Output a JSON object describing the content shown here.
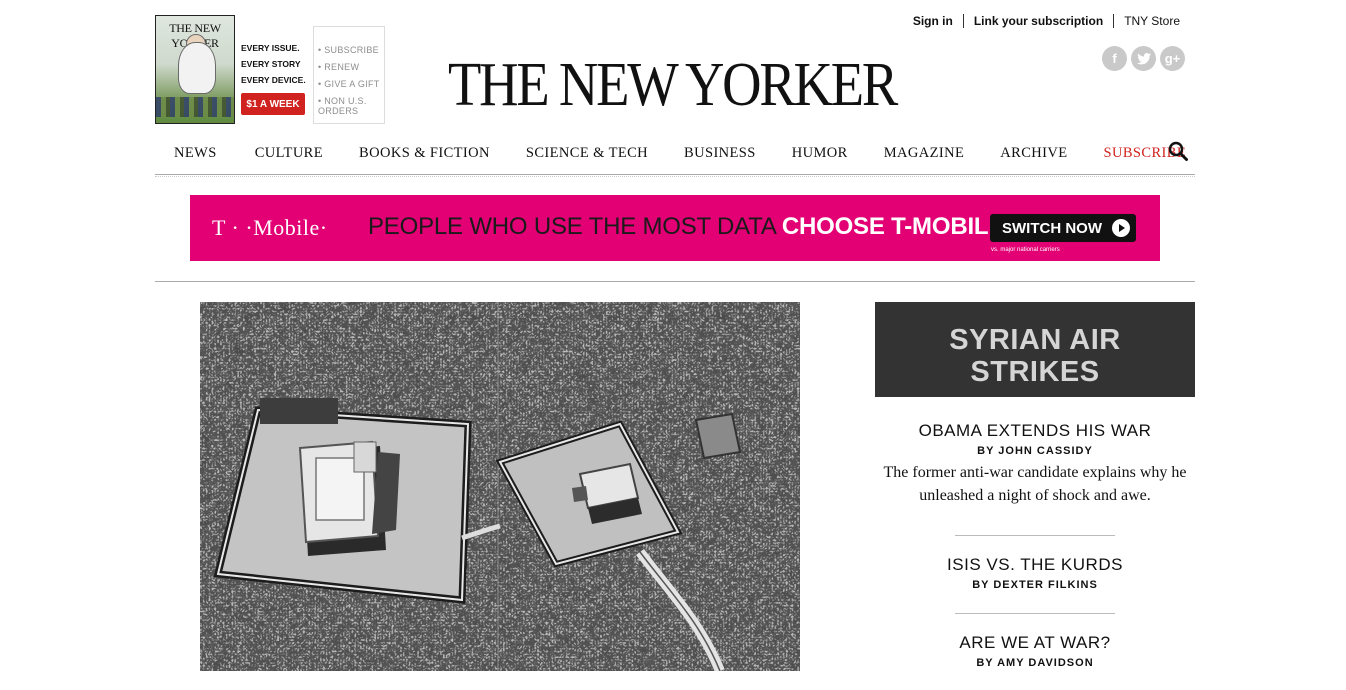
{
  "promo": {
    "cover_title": "THE NEW YORKER",
    "lines": [
      "EVERY ISSUE.",
      "EVERY STORY",
      "EVERY DEVICE."
    ],
    "price_button": "$1 A WEEK",
    "links": [
      "• SUBSCRIBE",
      "• RENEW",
      "• GIVE A GIFT",
      "• NON U.S.",
      "ORDERS"
    ]
  },
  "utility": {
    "sign_in": "Sign in",
    "link_subscription": "Link your subscription",
    "store": "TNY Store"
  },
  "social": {
    "facebook": "f",
    "twitter": "t",
    "googleplus": "g+"
  },
  "logo": "THE NEW YORKER",
  "nav": {
    "items": [
      "NEWS",
      "CULTURE",
      "BOOKS & FICTION",
      "SCIENCE & TECH",
      "BUSINESS",
      "HUMOR",
      "MAGAZINE",
      "ARCHIVE",
      "SUBSCRIBE"
    ]
  },
  "ad": {
    "brand": "T · ·Mobile·",
    "headline_plain": "PEOPLE WHO USE THE MOST DATA ",
    "headline_bold": "CHOOSE T-MOBILE",
    "cta": "SWITCH NOW",
    "fine_print": "vs. major national carriers",
    "color": "#e20074"
  },
  "rubric": "SYRIAN AIR STRIKES",
  "stories": [
    {
      "headline": "OBAMA EXTENDS HIS WAR",
      "byline": "BY JOHN CASSIDY",
      "dek": "The former anti-war candidate explains why he unleashed a night of shock and awe."
    },
    {
      "headline": "ISIS VS. THE KURDS",
      "byline": "BY DEXTER FILKINS"
    },
    {
      "headline": "ARE WE AT WAR?",
      "byline": "BY AMY DAVIDSON"
    }
  ]
}
